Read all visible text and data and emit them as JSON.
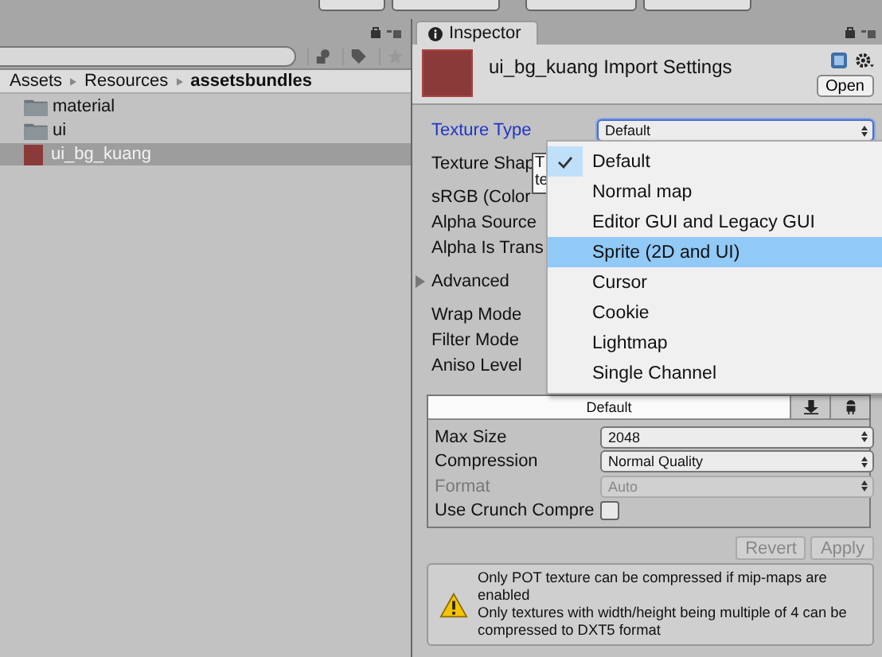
{
  "project": {
    "breadcrumb": [
      {
        "label": "Assets",
        "current": false
      },
      {
        "label": "Resources",
        "current": false
      },
      {
        "label": "assetsbundles",
        "current": true
      }
    ],
    "items": [
      {
        "name": "material",
        "kind": "folder",
        "selected": false
      },
      {
        "name": "ui",
        "kind": "folder",
        "selected": false
      },
      {
        "name": "ui_bg_kuang",
        "kind": "texture",
        "selected": true
      }
    ]
  },
  "inspector": {
    "tab": "Inspector",
    "title": "ui_bg_kuang Import Settings",
    "open_button": "Open",
    "texture_type": {
      "label": "Texture Type",
      "value": "Default"
    },
    "field_groups": [
      [
        {
          "label": "Texture Shap",
          "kind": "field"
        }
      ],
      [
        {
          "label": "sRGB (Color",
          "kind": "field"
        },
        {
          "label": "Alpha Source",
          "kind": "field"
        },
        {
          "label": "Alpha Is Trans",
          "kind": "field"
        }
      ],
      [
        {
          "label": "Advanced",
          "kind": "foldout",
          "expanded": false
        }
      ],
      [
        {
          "label": "Wrap Mode",
          "kind": "field"
        },
        {
          "label": "Filter Mode",
          "kind": "field"
        },
        {
          "label": "Aniso Level",
          "kind": "field"
        }
      ]
    ],
    "platform": {
      "tabs": [
        {
          "kind": "text",
          "label": "Default",
          "selected": true
        },
        {
          "kind": "download",
          "selected": false
        },
        {
          "kind": "android",
          "selected": false
        }
      ],
      "rows": [
        {
          "label": "Max Size",
          "value": "2048",
          "disabled": false
        },
        {
          "label": "Compression",
          "value": "Normal Quality",
          "disabled": false
        },
        {
          "label": "Format",
          "value": "Auto",
          "disabled": true
        }
      ],
      "checkbox": {
        "label": "Use Crunch Compre",
        "checked": false
      }
    },
    "buttons": [
      {
        "label": "Revert",
        "disabled": true
      },
      {
        "label": "Apply",
        "disabled": true
      }
    ],
    "help": {
      "kind": "warning",
      "lines": [
        "Only POT texture can be compressed if mip-maps are enabled",
        "Only textures with width/height being multiple of 4 can be compressed to DXT5 format"
      ]
    }
  },
  "tooltip": {
    "lines": [
      "T",
      "te"
    ]
  },
  "dropdown": {
    "options": [
      {
        "label": "Default",
        "selected": true,
        "hovered": false
      },
      {
        "label": "Normal map",
        "selected": false,
        "hovered": false
      },
      {
        "label": "Editor GUI and Legacy GUI",
        "selected": false,
        "hovered": false
      },
      {
        "label": "Sprite (2D and UI)",
        "selected": false,
        "hovered": true
      },
      {
        "label": "Cursor",
        "selected": false,
        "hovered": false
      },
      {
        "label": "Cookie",
        "selected": false,
        "hovered": false
      },
      {
        "label": "Lightmap",
        "selected": false,
        "hovered": false
      },
      {
        "label": "Single Channel",
        "selected": false,
        "hovered": false
      }
    ]
  }
}
